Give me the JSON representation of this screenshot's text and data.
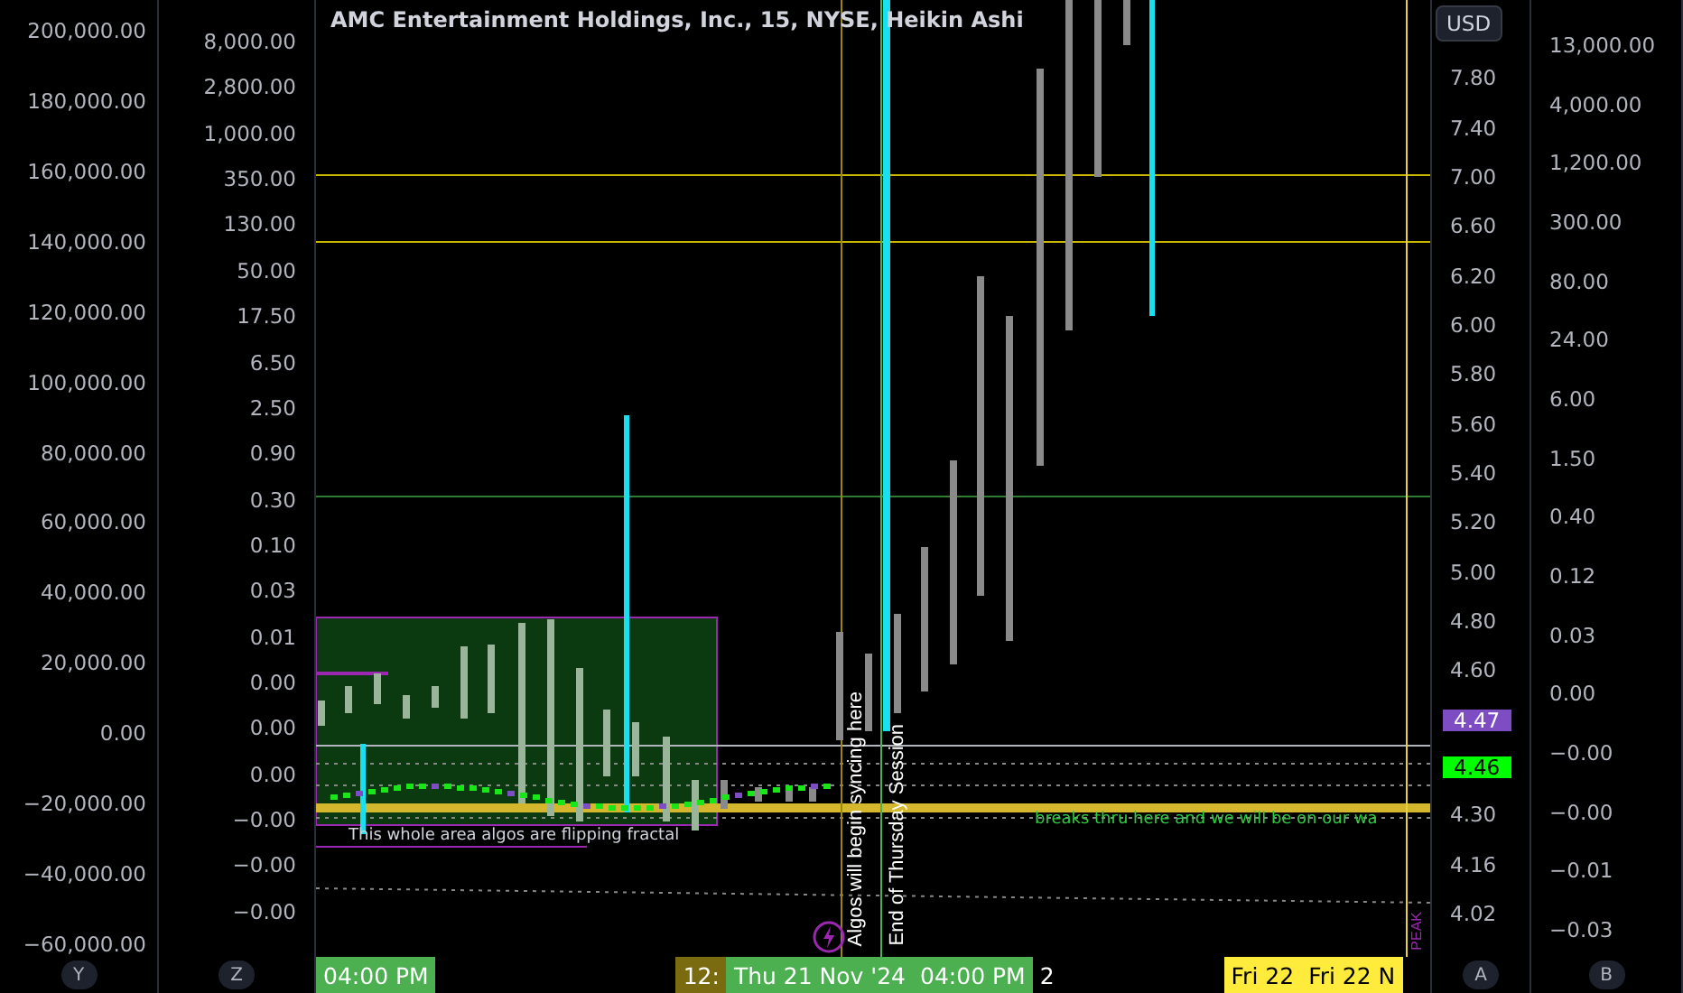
{
  "chart": {
    "title": "AMC Entertainment Holdings, Inc., 15, NYSE, Heikin Ashi",
    "annotations": [
      {
        "kind": "box-note",
        "text": "This whole area algos are flipping fractal"
      },
      {
        "kind": "vertical",
        "text": "Algos will begin syncing here"
      },
      {
        "kind": "vertical",
        "text": "End of Thursday Session"
      },
      {
        "kind": "line-note",
        "text": "breaks thru here and we will be on our wa"
      },
      {
        "kind": "peak",
        "text": "PEAK"
      }
    ]
  },
  "left_axis_1": [
    "200,000.00",
    "180,000.00",
    "160,000.00",
    "140,000.00",
    "120,000.00",
    "100,000.00",
    "80,000.00",
    "60,000.00",
    "40,000.00",
    "20,000.00",
    "0.00",
    "−20,000.00",
    "−40,000.00",
    "−60,000.00"
  ],
  "left_axis_2": [
    "8,000.00",
    "2,800.00",
    "1,000.00",
    "350.00",
    "130.00",
    "50.00",
    "17.50",
    "6.50",
    "2.50",
    "0.90",
    "0.30",
    "0.10",
    "0.03",
    "0.01",
    "0.00",
    "0.00",
    "0.00",
    "−0.00",
    "−0.00",
    "−0.00"
  ],
  "right_axis_1": {
    "currency": "USD",
    "labels": [
      {
        "kind": "tick",
        "text": "7.80"
      },
      {
        "kind": "tick",
        "text": "7.40"
      },
      {
        "kind": "tick",
        "text": "7.00"
      },
      {
        "kind": "tick",
        "text": "6.60"
      },
      {
        "kind": "tick",
        "text": "6.20"
      },
      {
        "kind": "tick",
        "text": "6.00"
      },
      {
        "kind": "tick",
        "text": "5.80"
      },
      {
        "kind": "tick",
        "text": "5.60"
      },
      {
        "kind": "tick",
        "text": "5.40"
      },
      {
        "kind": "tick",
        "text": "5.20"
      },
      {
        "kind": "tick",
        "text": "5.00"
      },
      {
        "kind": "tick",
        "text": "4.80"
      },
      {
        "kind": "tick",
        "text": "4.60"
      },
      {
        "kind": "tag",
        "text": "4.47",
        "color": "#7e4dc4"
      },
      {
        "kind": "tag",
        "text": "4.46",
        "color": "#00ff00"
      },
      {
        "kind": "tick",
        "text": "4.30"
      },
      {
        "kind": "tick",
        "text": "4.16"
      },
      {
        "kind": "tick",
        "text": "4.02"
      }
    ]
  },
  "right_axis_2": [
    "13,000.00",
    "4,000.00",
    "1,200.00",
    "300.00",
    "80.00",
    "24.00",
    "6.00",
    "1.50",
    "0.40",
    "0.12",
    "0.03",
    "0.00",
    "−0.00",
    "−0.00",
    "−0.01",
    "−0.03"
  ],
  "time_axis": [
    {
      "kind": "highlight",
      "color": "#4caf50",
      "labels": [
        "04:00 PM"
      ]
    },
    {
      "kind": "highlight",
      "color": "#7a6a10",
      "labels": [
        "12:"
      ]
    },
    {
      "kind": "highlight",
      "color": "#4caf50",
      "labels": [
        "Thu 21 Nov '24",
        "04:00 PM"
      ]
    },
    {
      "kind": "plain",
      "labels": [
        "2"
      ]
    },
    {
      "kind": "highlight",
      "color": "#ffeb3b",
      "labels": [
        "Fri 22",
        "Fri 22 N"
      ]
    }
  ],
  "axis_buttons": [
    "Y",
    "Z",
    "A",
    "B"
  ]
}
